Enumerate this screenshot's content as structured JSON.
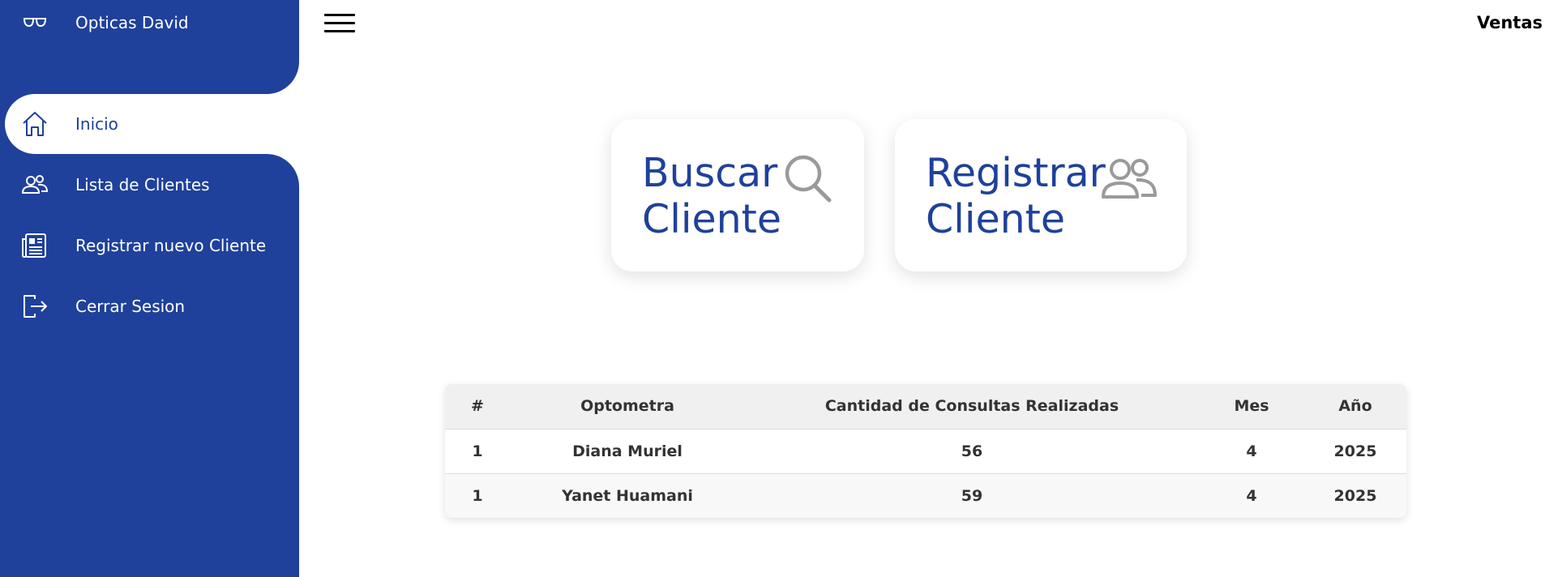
{
  "sidebar": {
    "brand": {
      "icon": "glasses-icon",
      "label": "Opticas David"
    },
    "items": [
      {
        "label": "Inicio",
        "icon": "home-icon",
        "active": true
      },
      {
        "label": "Lista de Clientes",
        "icon": "users-icon",
        "active": false
      },
      {
        "label": "Registrar nuevo Cliente",
        "icon": "newspaper-icon",
        "active": false
      },
      {
        "label": "Cerrar Sesion",
        "icon": "logout-icon",
        "active": false
      }
    ]
  },
  "header": {
    "title": "Ventas",
    "menu_icon": "hamburger-icon"
  },
  "cards": [
    {
      "line1": "Buscar",
      "line2": "Cliente",
      "icon": "search-icon"
    },
    {
      "line1": "Registrar",
      "line2": "Cliente",
      "icon": "users-icon"
    }
  ],
  "table": {
    "columns": [
      "#",
      "Optometra",
      "Cantidad de Consultas Realizadas",
      "Mes",
      "Año"
    ],
    "rows": [
      [
        "1",
        "Diana Muriel",
        "56",
        "4",
        "2025"
      ],
      [
        "1",
        "Yanet Huamani",
        "59",
        "4",
        "2025"
      ]
    ]
  },
  "colors": {
    "primary": "#1f419b",
    "icon_gray": "#9a9a9a",
    "text_dark": "#333333"
  }
}
